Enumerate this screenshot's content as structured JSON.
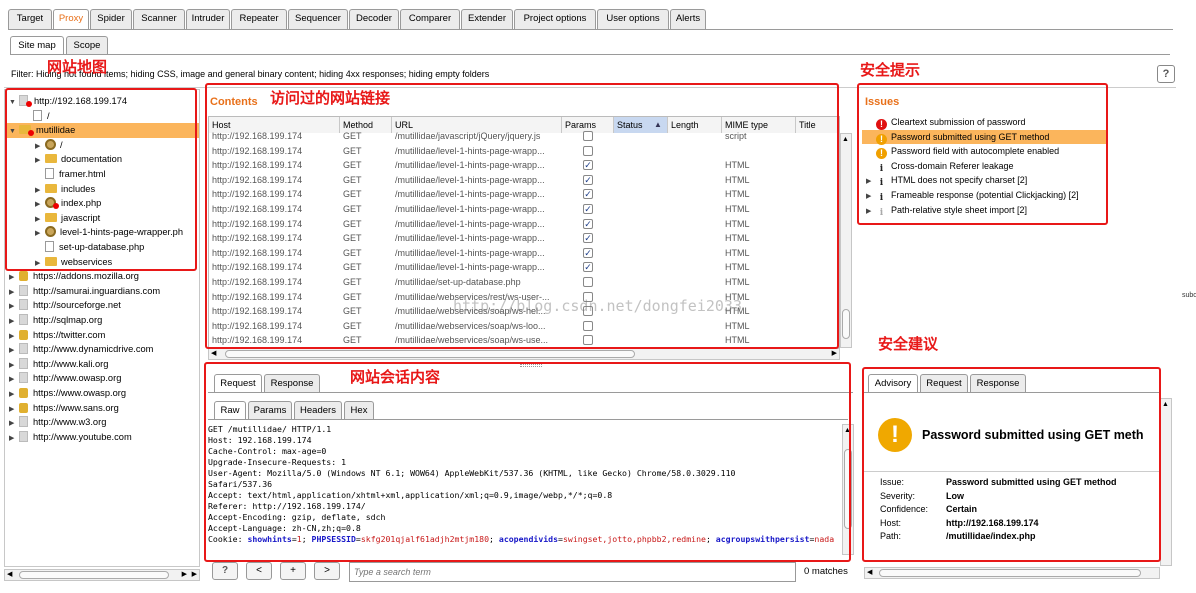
{
  "top_tabs": [
    "Target",
    "Proxy",
    "Spider",
    "Scanner",
    "Intruder",
    "Repeater",
    "Sequencer",
    "Decoder",
    "Comparer",
    "Extender",
    "Project options",
    "User options",
    "Alerts"
  ],
  "sub_tabs": [
    "Site map",
    "Scope"
  ],
  "filter_text": "Filter: Hiding not found items;  hiding CSS, image and general binary content;  hiding 4xx responses;  hiding empty folders",
  "help_label": "?",
  "annotations": {
    "site_map": "网站地图",
    "visited_links": "访问过的网站链接",
    "security_hints": "安全提示",
    "session_content": "网站会话内容",
    "security_advice": "安全建议"
  },
  "tree": {
    "root": "http://192.168.199.174",
    "root_child": "/",
    "selected": "mutillidae",
    "children": [
      "/",
      "documentation",
      "framer.html",
      "includes",
      "index.php",
      "javascript",
      "level-1-hints-page-wrapper.ph",
      "set-up-database.php",
      "webservices"
    ],
    "other_hosts": [
      "https://addons.mozilla.org",
      "http://samurai.inguardians.com",
      "http://sourceforge.net",
      "http://sqlmap.org",
      "https://twitter.com",
      "http://www.dynamicdrive.com",
      "http://www.kali.org",
      "http://www.owasp.org",
      "https://www.owasp.org",
      "https://www.sans.org",
      "http://www.w3.org",
      "http://www.youtube.com"
    ]
  },
  "contents": {
    "title": "Contents",
    "columns": [
      "Host",
      "Method",
      "URL",
      "Params",
      "Status",
      "Length",
      "MIME type",
      "Title"
    ],
    "sort_indicator": "▲",
    "rows": [
      {
        "host": "http://192.168.199.174",
        "method": "GET",
        "url": "/mutillidae/javascript/jQuery/jquery.js",
        "params": false,
        "mime": "script"
      },
      {
        "host": "http://192.168.199.174",
        "method": "GET",
        "url": "/mutillidae/level-1-hints-page-wrapp...",
        "params": false,
        "mime": ""
      },
      {
        "host": "http://192.168.199.174",
        "method": "GET",
        "url": "/mutillidae/level-1-hints-page-wrapp...",
        "params": true,
        "mime": "HTML"
      },
      {
        "host": "http://192.168.199.174",
        "method": "GET",
        "url": "/mutillidae/level-1-hints-page-wrapp...",
        "params": true,
        "mime": "HTML"
      },
      {
        "host": "http://192.168.199.174",
        "method": "GET",
        "url": "/mutillidae/level-1-hints-page-wrapp...",
        "params": true,
        "mime": "HTML"
      },
      {
        "host": "http://192.168.199.174",
        "method": "GET",
        "url": "/mutillidae/level-1-hints-page-wrapp...",
        "params": true,
        "mime": "HTML"
      },
      {
        "host": "http://192.168.199.174",
        "method": "GET",
        "url": "/mutillidae/level-1-hints-page-wrapp...",
        "params": true,
        "mime": "HTML"
      },
      {
        "host": "http://192.168.199.174",
        "method": "GET",
        "url": "/mutillidae/level-1-hints-page-wrapp...",
        "params": true,
        "mime": "HTML"
      },
      {
        "host": "http://192.168.199.174",
        "method": "GET",
        "url": "/mutillidae/level-1-hints-page-wrapp...",
        "params": true,
        "mime": "HTML"
      },
      {
        "host": "http://192.168.199.174",
        "method": "GET",
        "url": "/mutillidae/level-1-hints-page-wrapp...",
        "params": true,
        "mime": "HTML"
      },
      {
        "host": "http://192.168.199.174",
        "method": "GET",
        "url": "/mutillidae/set-up-database.php",
        "params": false,
        "mime": "HTML"
      },
      {
        "host": "http://192.168.199.174",
        "method": "GET",
        "url": "/mutillidae/webservices/rest/ws-user-...",
        "params": false,
        "mime": "HTML"
      },
      {
        "host": "http://192.168.199.174",
        "method": "GET",
        "url": "/mutillidae/webservices/soap/ws-hel...",
        "params": false,
        "mime": "HTML"
      },
      {
        "host": "http://192.168.199.174",
        "method": "GET",
        "url": "/mutillidae/webservices/soap/ws-loo...",
        "params": false,
        "mime": "HTML"
      },
      {
        "host": "http://192.168.199.174",
        "method": "GET",
        "url": "/mutillidae/webservices/soap/ws-use...",
        "params": false,
        "mime": "HTML"
      }
    ]
  },
  "watermark": "http://blog.csdn.net/dongfei2033",
  "edge_text": "subo",
  "issues": {
    "title": "Issues",
    "items": [
      {
        "label": "Cleartext submission of password",
        "kind": "high",
        "expandable": false,
        "selected": false
      },
      {
        "label": "Password submitted using GET method",
        "kind": "medium",
        "expandable": false,
        "selected": true
      },
      {
        "label": "Password field with autocomplete enabled",
        "kind": "medium",
        "expandable": false,
        "selected": false
      },
      {
        "label": "Cross-domain Referer leakage",
        "kind": "info",
        "expandable": false,
        "selected": false
      },
      {
        "label": "HTML does not specify charset [2]",
        "kind": "info",
        "expandable": true,
        "selected": false
      },
      {
        "label": "Frameable response (potential Clickjacking) [2]",
        "kind": "info",
        "expandable": true,
        "selected": false
      },
      {
        "label": "Path-relative style sheet import [2]",
        "kind": "info-light",
        "expandable": true,
        "selected": false
      }
    ]
  },
  "request_tabs": [
    "Request",
    "Response"
  ],
  "view_tabs": [
    "Raw",
    "Params",
    "Headers",
    "Hex"
  ],
  "request_lines": [
    "GET /mutillidae/ HTTP/1.1",
    "Host: 192.168.199.174",
    "Cache-Control: max-age=0",
    "Upgrade-Insecure-Requests: 1",
    "User-Agent: Mozilla/5.0 (Windows NT 6.1; WOW64) AppleWebKit/537.36 (KHTML, like Gecko) Chrome/58.0.3029.110",
    "Safari/537.36",
    "Accept: text/html,application/xhtml+xml,application/xml;q=0.9,image/webp,*/*;q=0.8",
    "Referer: http://192.168.199.174/",
    "Accept-Encoding: gzip, deflate, sdch",
    "Accept-Language: zh-CN,zh;q=0.8"
  ],
  "cookie": {
    "prefix": "Cookie: ",
    "parts": [
      {
        "k": "showhints",
        "v": "1"
      },
      {
        "k": "PHPSESSID",
        "v": "skfg201qjalf61adjh2mtjm180"
      },
      {
        "k": "acopendivids",
        "v": "swingset,jotto,phpbb2,redmine"
      },
      {
        "k": "acgroupswithpersist",
        "v": "nada"
      }
    ]
  },
  "search": {
    "placeholder": "Type a search term",
    "matches": "0 matches",
    "help": "?",
    "prev": "<",
    "add": "+",
    "next": ">"
  },
  "advisory_tabs": [
    "Advisory",
    "Request",
    "Response"
  ],
  "advisory": {
    "heading": "Password submitted using GET meth",
    "fields": [
      {
        "label": "Issue:",
        "value": "Password submitted using GET method"
      },
      {
        "label": "Severity:",
        "value": "Low"
      },
      {
        "label": "Confidence:",
        "value": "Certain"
      },
      {
        "label": "Host:",
        "value": "http://192.168.199.174"
      },
      {
        "label": "Path:",
        "value": "/mutillidae/index.php"
      }
    ]
  },
  "colors": {
    "accent": "#e8701a",
    "annotation": "#e81818",
    "selection": "#fbb55c",
    "high": "#e01010",
    "medium": "#f0a000"
  }
}
